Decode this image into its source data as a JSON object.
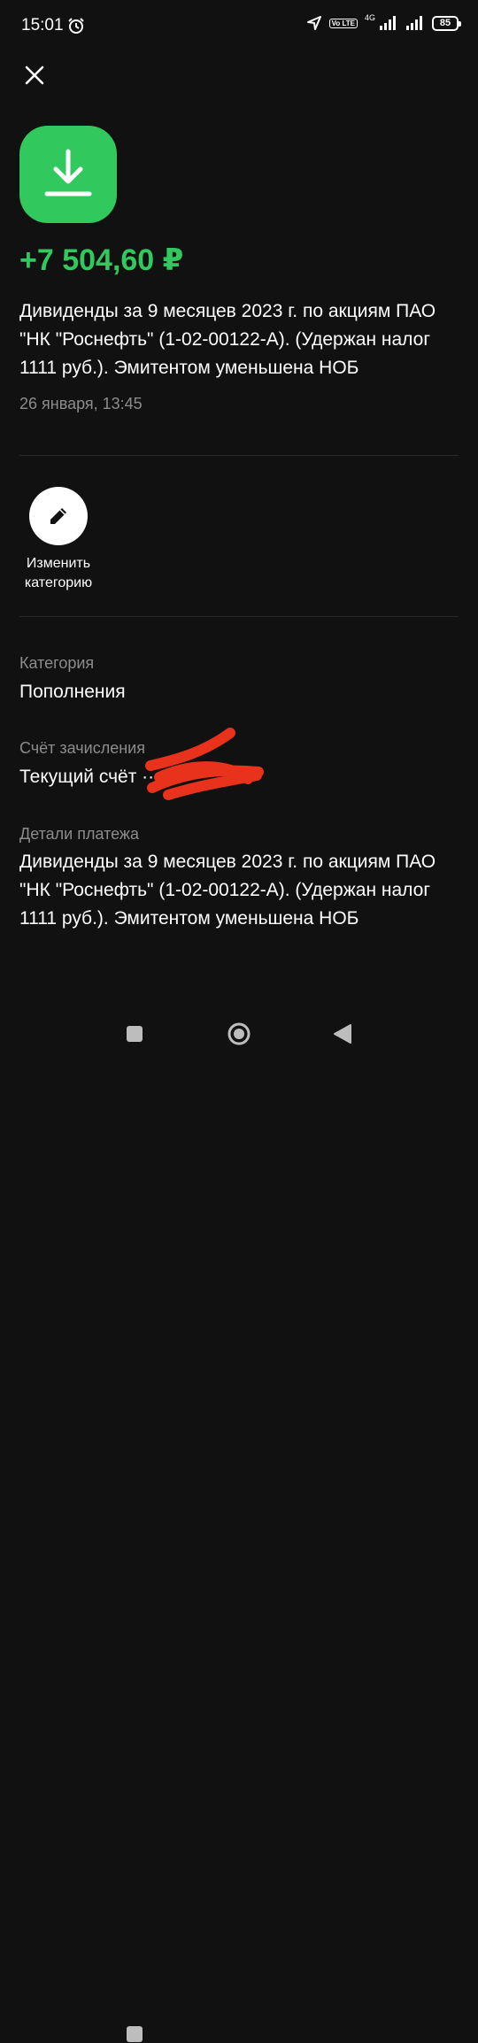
{
  "status_bar": {
    "time": "15:01",
    "volte_label": "Vo LTE",
    "network_label": "4G",
    "battery_level": "85"
  },
  "header": {
    "close_icon": "close-icon",
    "app_icon": "download-icon",
    "accent_color": "#31c85d"
  },
  "transaction": {
    "amount": "+7 504,60 ₽",
    "description": "Дивиденды за 9 месяцев 2023 г. по акциям ПАО \"НК \"Роснефть\" (1-02-00122-А). (Удержан налог 1111 руб.). Эмитентом уменьшена НОБ",
    "datetime": "26 января, 13:45"
  },
  "actions": {
    "change_category_label": "Изменить\nкатегорию",
    "change_category_icon": "pencil-icon"
  },
  "details": {
    "category_label": "Категория",
    "category_value": "Пополнения",
    "account_label": "Счёт зачисления",
    "account_value": "Текущий счёт ··",
    "payment_details_label": "Детали платежа",
    "payment_details_value": "Дивиденды за 9 месяцев 2023 г. по акциям ПАО \"НК \"Роснефть\" (1-02-00122-А). (Удержан налог 1111 руб.). Эмитентом уменьшена НОБ"
  },
  "nav_bar": {
    "recents_icon": "square-icon",
    "home_icon": "circle-icon",
    "back_icon": "triangle-back-icon"
  }
}
